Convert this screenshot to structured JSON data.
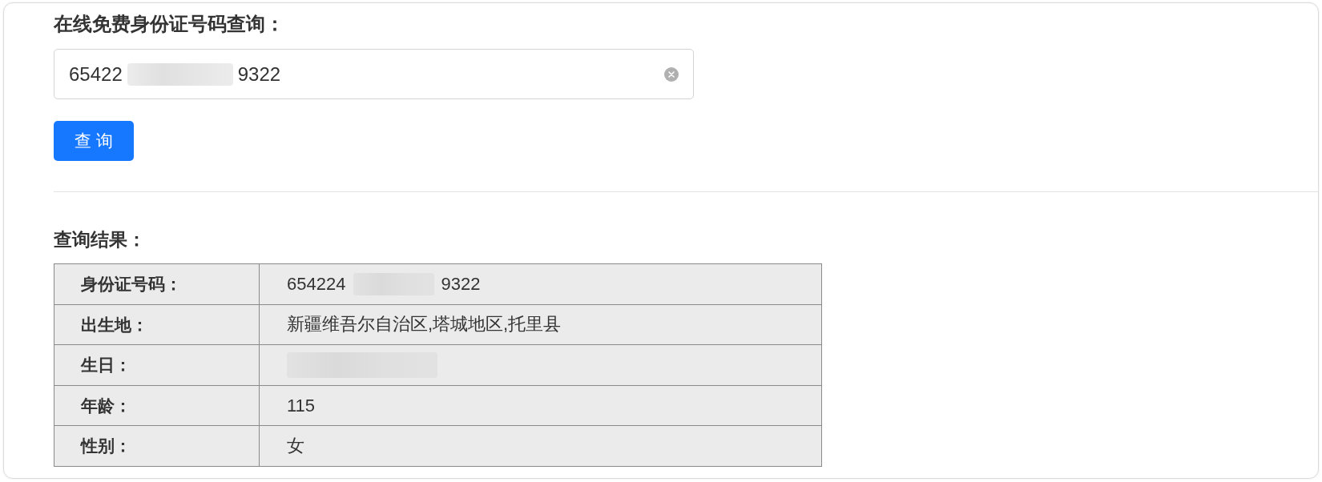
{
  "title": "在线免费身份证号码查询：",
  "search": {
    "value_segments": [
      {
        "kind": "text",
        "text": "65422"
      },
      {
        "kind": "blur"
      },
      {
        "kind": "text",
        "text": "9322"
      }
    ]
  },
  "query_button": {
    "label": "查 询"
  },
  "result": {
    "title": "查询结果：",
    "rows": [
      {
        "label": "身份证号码：",
        "segments": [
          {
            "kind": "text",
            "text": "654224"
          },
          {
            "kind": "blur"
          },
          {
            "kind": "text",
            "text": "9322"
          }
        ]
      },
      {
        "label": "出生地：",
        "segments": [
          {
            "kind": "text",
            "text": "新疆维吾尔自治区,塔城地区,托里县"
          }
        ]
      },
      {
        "label": "生日：",
        "segments": [
          {
            "kind": "blur"
          }
        ]
      },
      {
        "label": "年龄：",
        "segments": [
          {
            "kind": "text",
            "text": "115"
          }
        ]
      },
      {
        "label": "性别：",
        "segments": [
          {
            "kind": "text",
            "text": "女"
          }
        ]
      }
    ]
  }
}
